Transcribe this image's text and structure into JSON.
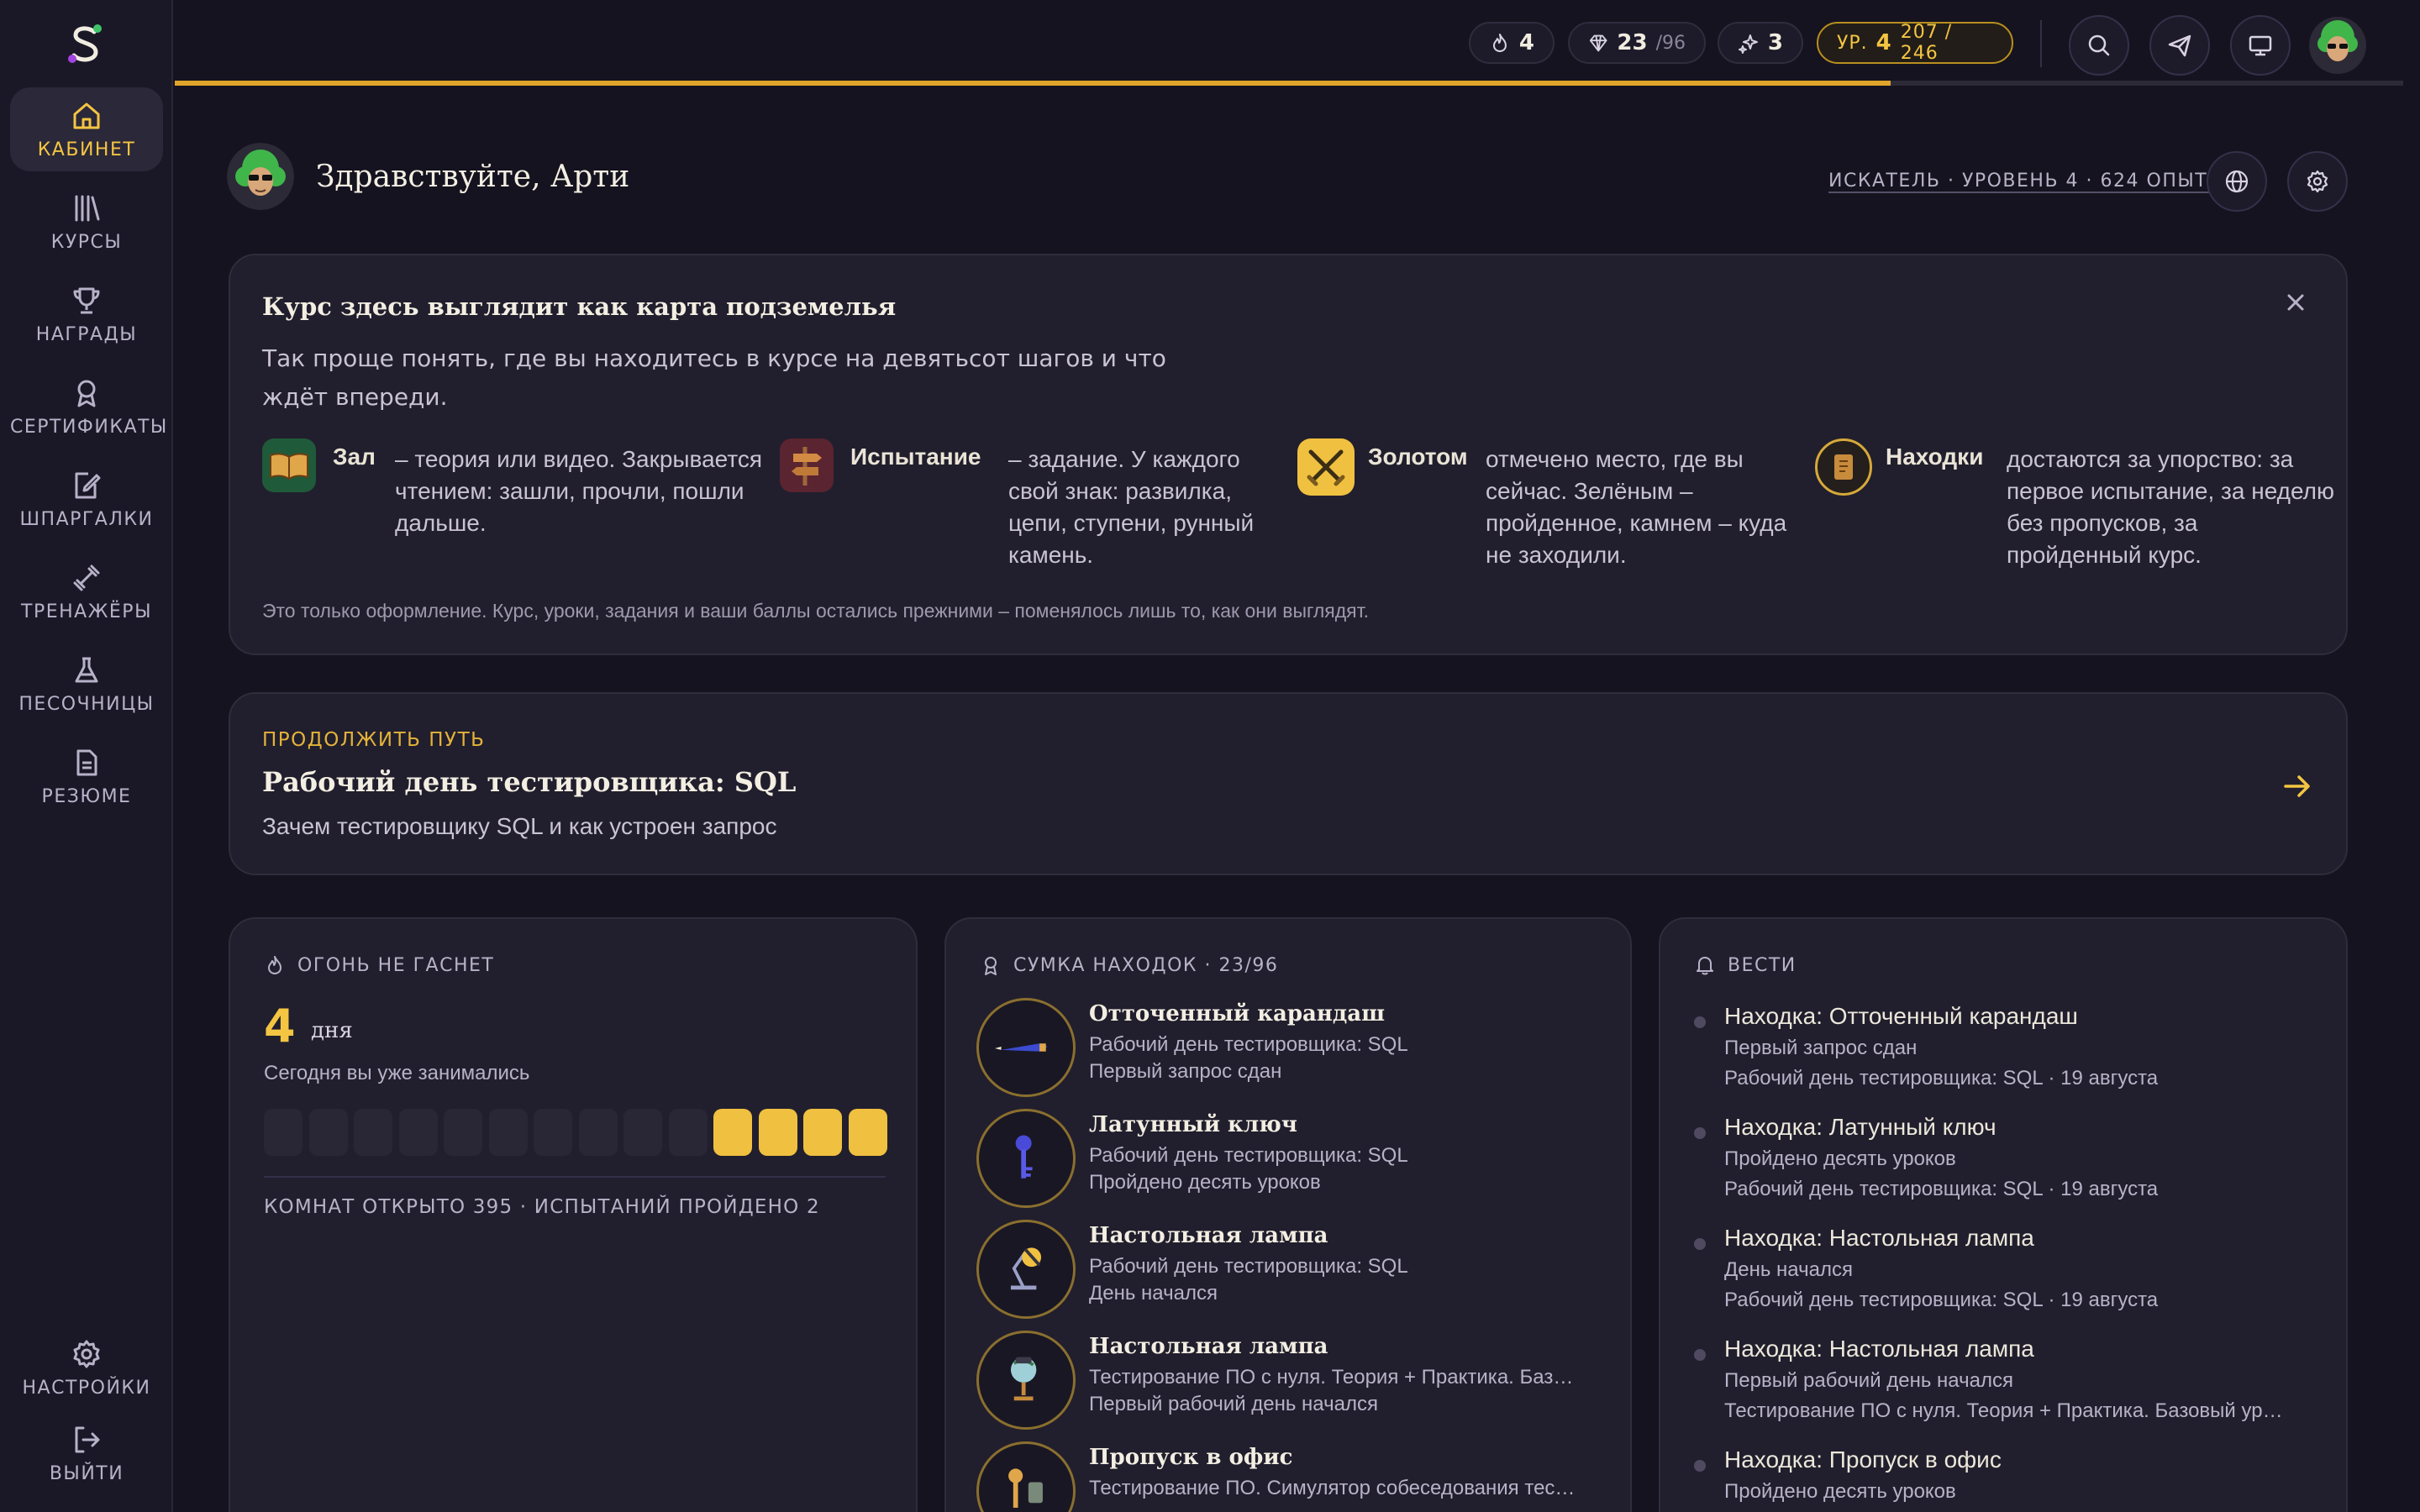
{
  "nav": {
    "items": [
      {
        "label": "КАБИНЕТ",
        "icon": "home-icon",
        "active": true
      },
      {
        "label": "КУРСЫ",
        "icon": "library-icon"
      },
      {
        "label": "НАГРАДЫ",
        "icon": "trophy-icon"
      },
      {
        "label": "СЕРТИФИКАТЫ",
        "icon": "award-icon"
      },
      {
        "label": "ШПАРГАЛКИ",
        "icon": "note-icon"
      },
      {
        "label": "ТРЕНАЖЁРЫ",
        "icon": "dumbbell-icon"
      },
      {
        "label": "ПЕСОЧНИЦЫ",
        "icon": "flask-icon"
      },
      {
        "label": "РЕЗЮМЕ",
        "icon": "document-icon"
      }
    ],
    "settings": "НАСТРОЙКИ",
    "logout": "ВЫЙТИ"
  },
  "topbar": {
    "streak": "4",
    "gems": "23",
    "gems_total": "/96",
    "sparks": "3",
    "level_prefix": "УР.",
    "level": "4",
    "xp": "207 / 246",
    "xp_progress": 0.77
  },
  "greeting": {
    "text": "Здравствуйте, Арти",
    "rank": "ИСКАТЕЛЬ · УРОВЕНЬ 4 · 624 ОПЫТА"
  },
  "intro": {
    "title": "Курс здесь выглядит как карта подземелья",
    "desc": "Так проще понять, где вы находитесь в курсе на девятьсот шагов и что ждёт впереди.",
    "legend": [
      {
        "name": "Зал",
        "desc": "– теория или видео. Закрывается чтением: зашли, прочли, пошли дальше."
      },
      {
        "name": "Испытание",
        "desc": "– задание. У каждого свой знак: развилка, цепи, ступени, рунный камень."
      },
      {
        "name": "Золотом",
        "desc": "отмечено место, где вы сейчас. Зелёным – пройденное, камнем – куда не заходили."
      },
      {
        "name": "Находки",
        "desc": "достаются за упорство: за первое испытание, за неделю без пропусков, за пройденный курс."
      }
    ],
    "note": "Это только оформление. Курс, уроки, задания и ваши баллы остались прежними – поменялось лишь то, как они выглядят."
  },
  "continue": {
    "label": "ПРОДОЛЖИТЬ ПУТЬ",
    "title": "Рабочий день тестировщика: SQL",
    "subtitle": "Зачем тестировщику SQL и как устроен запрос"
  },
  "streak": {
    "head": "ОГОНЬ НЕ ГАСНЕТ",
    "days": "4",
    "unit": "дня",
    "today": "Сегодня вы уже занимались",
    "cells_total": 14,
    "cells_on": 4,
    "stats": "КОМНАТ ОТКРЫТО 395 · ИСПЫТАНИЙ ПРОЙДЕНО 2"
  },
  "finds": {
    "head": "СУМКА НАХОДОК · 23/96",
    "items": [
      {
        "title": "Отточенный карандаш",
        "course": "Рабочий день тестировщика: SQL",
        "reason": "Первый запрос сдан",
        "icon": "pencil-icon"
      },
      {
        "title": "Латунный ключ",
        "course": "Рабочий день тестировщика: SQL",
        "reason": "Пройдено десять уроков",
        "icon": "key-icon"
      },
      {
        "title": "Настольная лампа",
        "course": "Рабочий день тестировщика: SQL",
        "reason": "День начался",
        "icon": "lamp-icon"
      },
      {
        "title": "Настольная лампа",
        "course": "Тестирование ПО с нуля. Теория + Практика. Баз…",
        "reason": "Первый рабочий день начался",
        "icon": "globe-lamp-icon"
      },
      {
        "title": "Пропуск в офис",
        "course": "Тестирование ПО. Симулятор собеседования тес…",
        "reason": "",
        "icon": "keys-icon"
      }
    ]
  },
  "news": {
    "head": "ВЕСТИ",
    "items": [
      {
        "title": "Находка: Отточенный карандаш",
        "line1": "Первый запрос сдан",
        "line2": "Рабочий день тестировщика: SQL · 19 августа"
      },
      {
        "title": "Находка: Латунный ключ",
        "line1": "Пройдено десять уроков",
        "line2": "Рабочий день тестировщика: SQL · 19 августа"
      },
      {
        "title": "Находка: Настольная лампа",
        "line1": "День начался",
        "line2": "Рабочий день тестировщика: SQL · 19 августа"
      },
      {
        "title": "Находка: Настольная лампа",
        "line1": "Первый рабочий день начался",
        "line2": "Тестирование ПО с нуля. Теория + Практика. Базовый ур…"
      },
      {
        "title": "Находка: Пропуск в офис",
        "line1": "Пройдено десять уроков",
        "line2": ""
      }
    ]
  },
  "colors": {
    "accent": "#f4c542",
    "bg": "#15131f",
    "card": "#211f2d"
  }
}
